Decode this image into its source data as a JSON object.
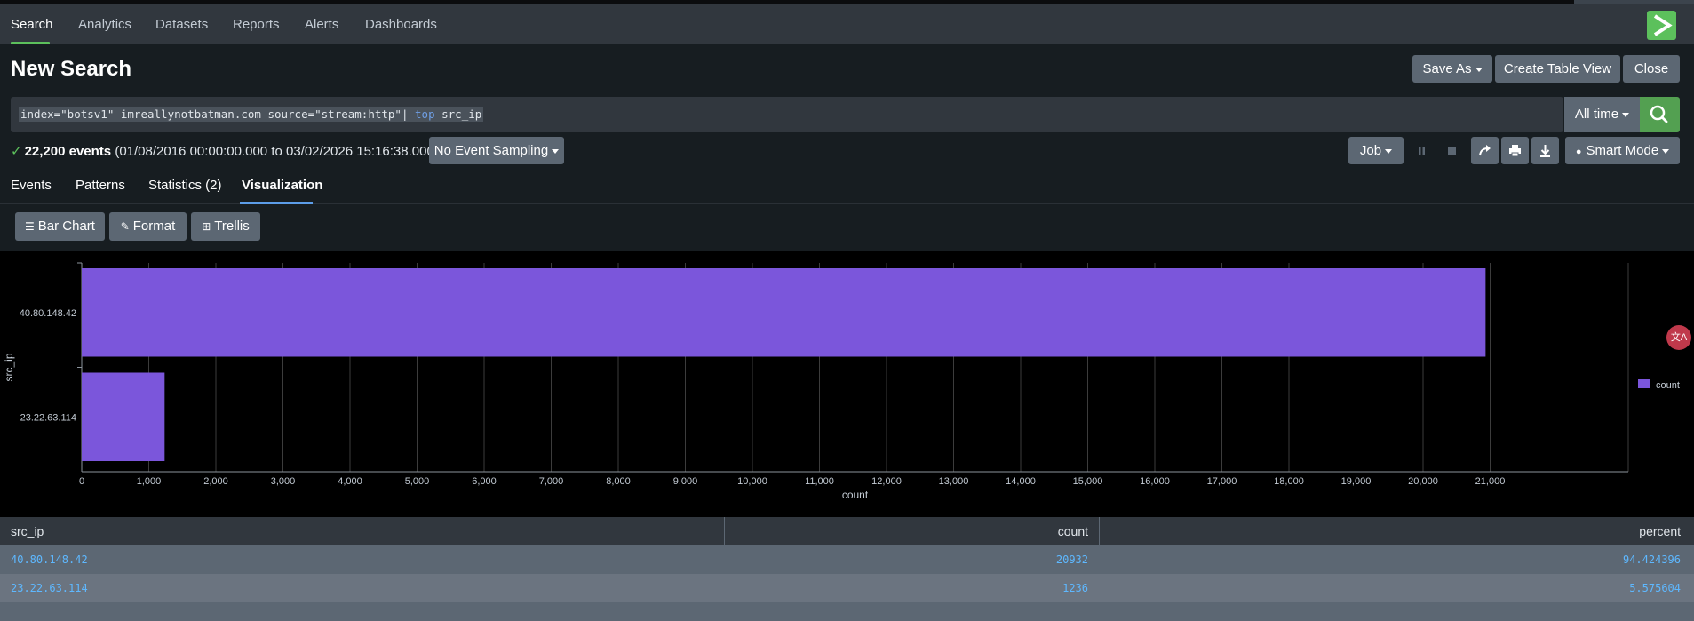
{
  "nav": {
    "tabs": [
      "Search",
      "Analytics",
      "Datasets",
      "Reports",
      "Alerts",
      "Dashboards"
    ]
  },
  "page": {
    "title": "New Search",
    "save_as": "Save As",
    "create_table_view": "Create Table View",
    "close": "Close"
  },
  "search": {
    "query_prefix": "index=\"botsv1\" imreallynotbatman.com source=\"stream:http\"| ",
    "query_keyword": "top",
    "query_suffix": " src_ip",
    "time_range": "All time"
  },
  "status": {
    "event_count": "22,200 events",
    "range": "(01/08/2016 00:00:00.000 to 03/02/2026 15:16:38.000)",
    "sampling": "No Event Sampling",
    "job": "Job",
    "mode": "Smart Mode"
  },
  "result_tabs": [
    "Events",
    "Patterns",
    "Statistics (2)",
    "Visualization"
  ],
  "viz_toolbar": {
    "chart_type": "Bar Chart",
    "format": "Format",
    "trellis": "Trellis"
  },
  "chart_data": {
    "type": "bar",
    "orientation": "horizontal",
    "categories": [
      "40.80.148.42",
      "23.22.63.114"
    ],
    "series": [
      {
        "name": "count",
        "values": [
          20932,
          1236
        ]
      }
    ],
    "xlabel": "count",
    "ylabel": "src_ip",
    "xlim": [
      0,
      22000
    ],
    "xticks": [
      0,
      1000,
      2000,
      3000,
      4000,
      5000,
      6000,
      7000,
      8000,
      9000,
      10000,
      11000,
      12000,
      13000,
      14000,
      15000,
      16000,
      17000,
      18000,
      19000,
      20000,
      21000
    ],
    "xtick_labels": [
      "0",
      "1,000",
      "2,000",
      "3,000",
      "4,000",
      "5,000",
      "6,000",
      "7,000",
      "8,000",
      "9,000",
      "10,000",
      "11,000",
      "12,000",
      "13,000",
      "14,000",
      "15,000",
      "16,000",
      "17,000",
      "18,000",
      "19,000",
      "20,000",
      "21,000"
    ],
    "grid": true,
    "legend": "right",
    "colors": {
      "bar": "#7b56db",
      "background": "#000000",
      "grid": "#3c3c3c"
    }
  },
  "table": {
    "columns": [
      "src_ip",
      "count",
      "percent"
    ],
    "rows": [
      [
        "40.80.148.42",
        "20932",
        "94.424396"
      ],
      [
        "23.22.63.114",
        "1236",
        "5.575604"
      ]
    ]
  }
}
